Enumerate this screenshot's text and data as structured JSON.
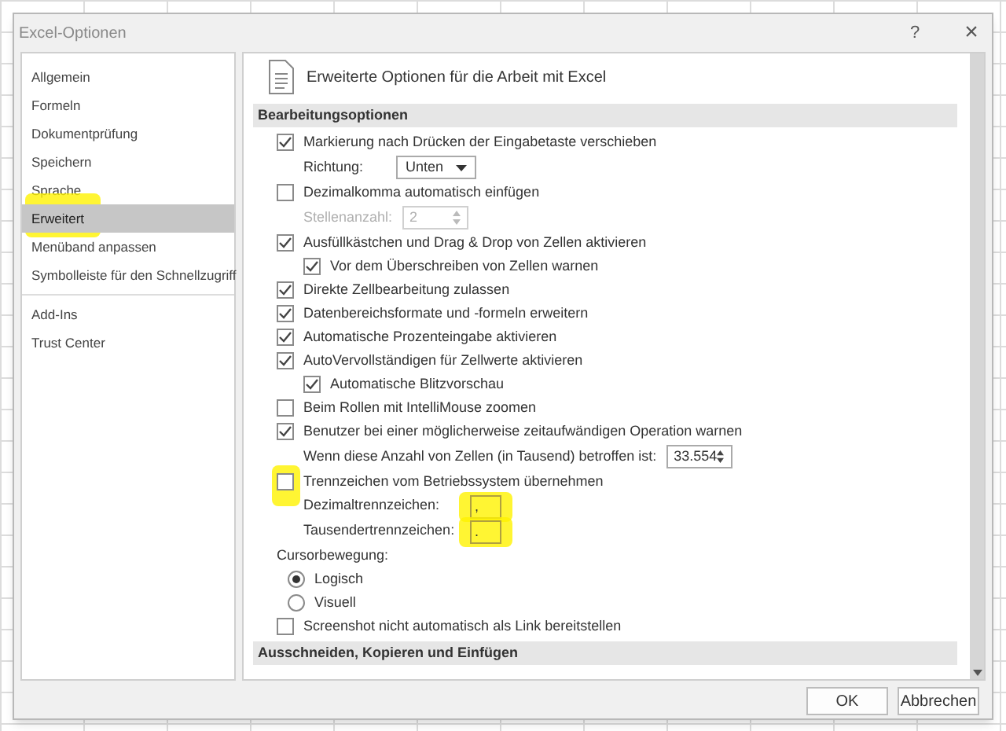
{
  "window": {
    "title": "Excel-Optionen",
    "help": "?",
    "close": "×"
  },
  "sidebar": {
    "groups": [
      [
        {
          "label": "Allgemein",
          "selected": false,
          "highlighted": false
        },
        {
          "label": "Formeln",
          "selected": false,
          "highlighted": false
        },
        {
          "label": "Dokumentprüfung",
          "selected": false,
          "highlighted": false
        },
        {
          "label": "Speichern",
          "selected": false,
          "highlighted": false
        },
        {
          "label": "Sprache",
          "selected": false,
          "highlighted": false
        },
        {
          "label": "Erweitert",
          "selected": true,
          "highlighted": true
        },
        {
          "label": "Menüband anpassen",
          "selected": false,
          "highlighted": false
        },
        {
          "label": "Symbolleiste für den Schnellzugriff",
          "selected": false,
          "highlighted": false
        }
      ],
      [
        {
          "label": "Add-Ins",
          "selected": false,
          "highlighted": false
        },
        {
          "label": "Trust Center",
          "selected": false,
          "highlighted": false
        }
      ]
    ]
  },
  "page": {
    "title": "Erweiterte Optionen für die Arbeit mit Excel",
    "items": [
      {
        "kind": "section",
        "label": "Bearbeitungsoptionen"
      },
      {
        "kind": "checkbox",
        "label": "Markierung nach Drücken der Eingabetaste verschieben",
        "checked": true,
        "children": [
          {
            "kind": "dropdown",
            "label": "Richtung:",
            "value": "Unten",
            "disabled": false
          }
        ]
      },
      {
        "kind": "checkbox",
        "label": "Dezimalkomma automatisch einfügen",
        "checked": false,
        "children": [
          {
            "kind": "spinner",
            "label": "Stellenanzahl:",
            "value": "2",
            "disabled": true
          }
        ]
      },
      {
        "kind": "checkbox",
        "label": "Ausfüllkästchen und Drag & Drop von Zellen aktivieren",
        "checked": true,
        "children": [
          {
            "kind": "checkbox",
            "label": "Vor dem Überschreiben von Zellen warnen",
            "checked": true
          }
        ]
      },
      {
        "kind": "checkbox",
        "label": "Direkte Zellbearbeitung zulassen",
        "checked": true
      },
      {
        "kind": "checkbox",
        "label": "Datenbereichsformate und -formeln erweitern",
        "checked": true
      },
      {
        "kind": "checkbox",
        "label": "Automatische Prozenteingabe aktivieren",
        "checked": true
      },
      {
        "kind": "checkbox",
        "label": "AutoVervollständigen für Zellwerte aktivieren",
        "checked": true,
        "children": [
          {
            "kind": "checkbox",
            "label": "Automatische Blitzvorschau",
            "checked": true
          }
        ]
      },
      {
        "kind": "checkbox",
        "label": "Beim Rollen mit IntelliMouse zoomen",
        "checked": false
      },
      {
        "kind": "checkbox",
        "label": "Benutzer bei einer möglicherweise zeitaufwändigen Operation warnen",
        "checked": true,
        "children": [
          {
            "kind": "spinner",
            "label": "Wenn diese Anzahl von Zellen (in Tausend) betroffen ist:",
            "value": "33.554",
            "disabled": false
          }
        ]
      },
      {
        "kind": "checkbox",
        "label": "Trennzeichen vom Betriebssystem übernehmen",
        "checked": false,
        "highlighted": true,
        "children": [
          {
            "kind": "textfield",
            "label": "Dezimaltrennzeichen:",
            "value": ",",
            "highlighted": true
          },
          {
            "kind": "textfield",
            "label": "Tausendertrennzeichen:",
            "value": ".",
            "highlighted": true
          }
        ]
      },
      {
        "kind": "label",
        "label": "Cursorbewegung:",
        "children": [
          {
            "kind": "radio",
            "label": "Logisch",
            "selected": true
          },
          {
            "kind": "radio",
            "label": "Visuell",
            "selected": false
          }
        ]
      },
      {
        "kind": "checkbox",
        "label": "Screenshot nicht automatisch als Link bereitstellen",
        "checked": false
      },
      {
        "kind": "section",
        "label": "Ausschneiden, Kopieren und Einfügen"
      }
    ]
  },
  "buttons": [
    "OK",
    "Abbrechen"
  ]
}
